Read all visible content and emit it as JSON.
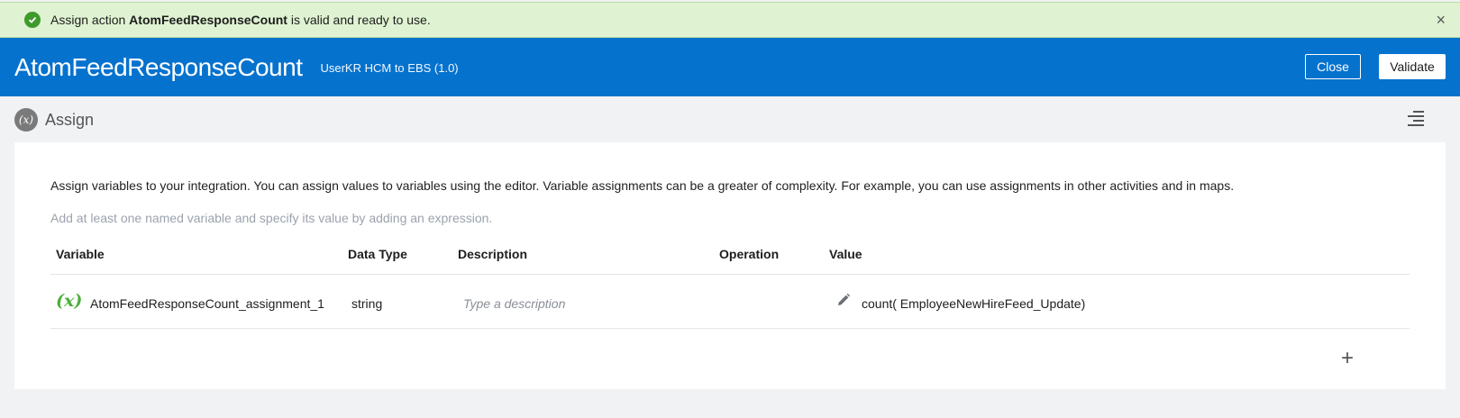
{
  "banner": {
    "prefix": "Assign action",
    "name": "AtomFeedResponseCount",
    "suffix": "is valid and ready to use.",
    "icon": "check-circle-icon",
    "close_glyph": "×"
  },
  "header": {
    "title": "AtomFeedResponseCount",
    "subtitle": "UserKR HCM to EBS (1.0)",
    "close_label": "Close",
    "validate_label": "Validate",
    "background": "#0572ce"
  },
  "section": {
    "title": "Assign",
    "badge": "(x)",
    "menu_icon": "list-menu-icon"
  },
  "content": {
    "description": "Assign variables to your integration. You can assign values to variables using the editor. Variable assignments can be a greater of complexity. For example, you can use assignments in other activities and in maps.",
    "hint": "Add at least one named variable and specify its value by adding an expression."
  },
  "table": {
    "columns": [
      "Variable",
      "Data Type",
      "Description",
      "Operation",
      "Value"
    ],
    "rows": [
      {
        "icon_text": "(x)",
        "variable": "AtomFeedResponseCount_assignment_1",
        "data_type": "string",
        "description_placeholder": "Type a description",
        "operation": "",
        "value": "count( EmployeeNewHireFeed_Update)"
      }
    ],
    "add_glyph": "+"
  }
}
